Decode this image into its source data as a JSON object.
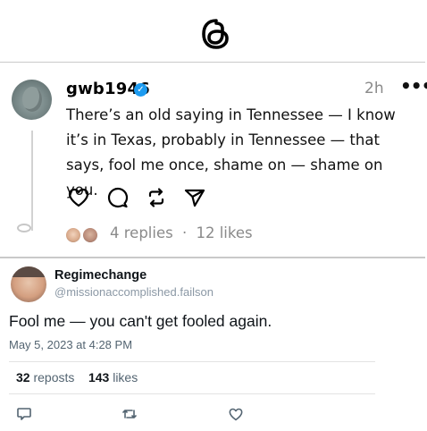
{
  "app": {
    "logo_icon": "threads-logo-icon"
  },
  "post": {
    "username": "gwb1946",
    "verified_icon": "verified-badge-icon",
    "time": "2h",
    "more_label": "•••",
    "text": "There’s an old saying in Tennessee — I know it’s in Texas, probably in Tennessee — that says, fool me once, shame on — shame on you.",
    "actions": [
      "heart-icon",
      "comment-icon",
      "repost-icon",
      "share-icon"
    ],
    "replies": "4 replies",
    "separator": "·",
    "likes": "12 likes"
  },
  "reply": {
    "name": "Regimechange",
    "handle": "@missionaccomplished.failson",
    "text": "Fool me — you can't get fooled again.",
    "date": "May 5, 2023 at 4:28 PM",
    "reposts_count": "32",
    "reposts_label": "reposts",
    "likes_count": "143",
    "likes_label": "likes",
    "actions": [
      "reply-icon",
      "retweet-icon",
      "like-icon"
    ]
  },
  "colors": {
    "accent": "#1d9bf0",
    "muted": "#8a8a8a"
  }
}
